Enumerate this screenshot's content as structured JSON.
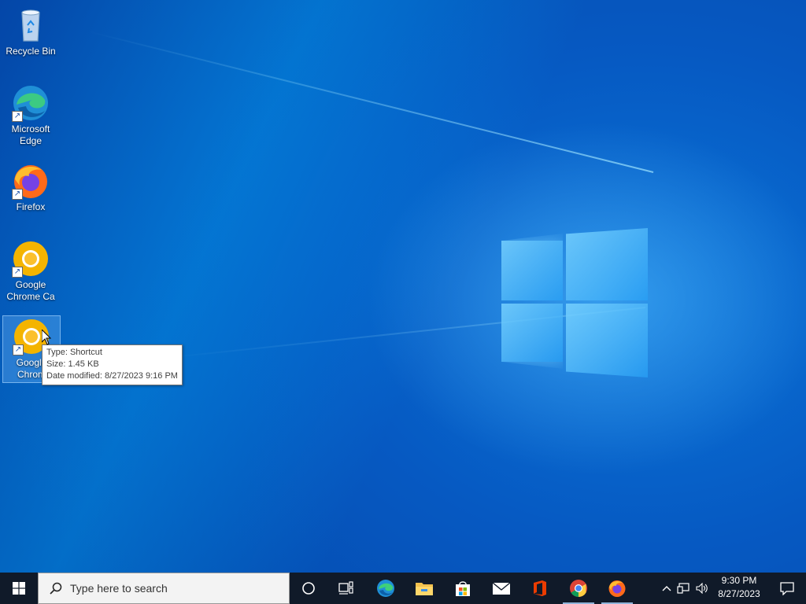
{
  "desktop": {
    "icons": [
      {
        "label": "Recycle Bin",
        "icon": "recycle-bin-icon",
        "shortcut": false
      },
      {
        "label": "Microsoft Edge",
        "icon": "edge-icon",
        "shortcut": true
      },
      {
        "label": "Firefox",
        "icon": "firefox-icon",
        "shortcut": true
      },
      {
        "label": "Google Chrome Ca",
        "icon": "chrome-canary-icon",
        "shortcut": true
      },
      {
        "label": "Google Chrom",
        "icon": "chrome-canary-icon",
        "shortcut": true
      }
    ],
    "tooltip": {
      "type": "Type: Shortcut",
      "size": "Size: 1.45 KB",
      "modified": "Date modified: 8/27/2023 9:16 PM"
    }
  },
  "taskbar": {
    "search_placeholder": "Type here to search",
    "pinned": [
      "Cortana",
      "Task View",
      "Microsoft Edge",
      "File Explorer",
      "Microsoft Store",
      "Mail",
      "Office",
      "Google Chrome",
      "Firefox"
    ],
    "clock": {
      "time": "9:30 PM",
      "date": "8/27/2023"
    }
  },
  "colors": {
    "desktop_blue": "#0a5fc6",
    "taskbar": "#101a29",
    "chrome_canary_yellow": "#f4b400"
  }
}
